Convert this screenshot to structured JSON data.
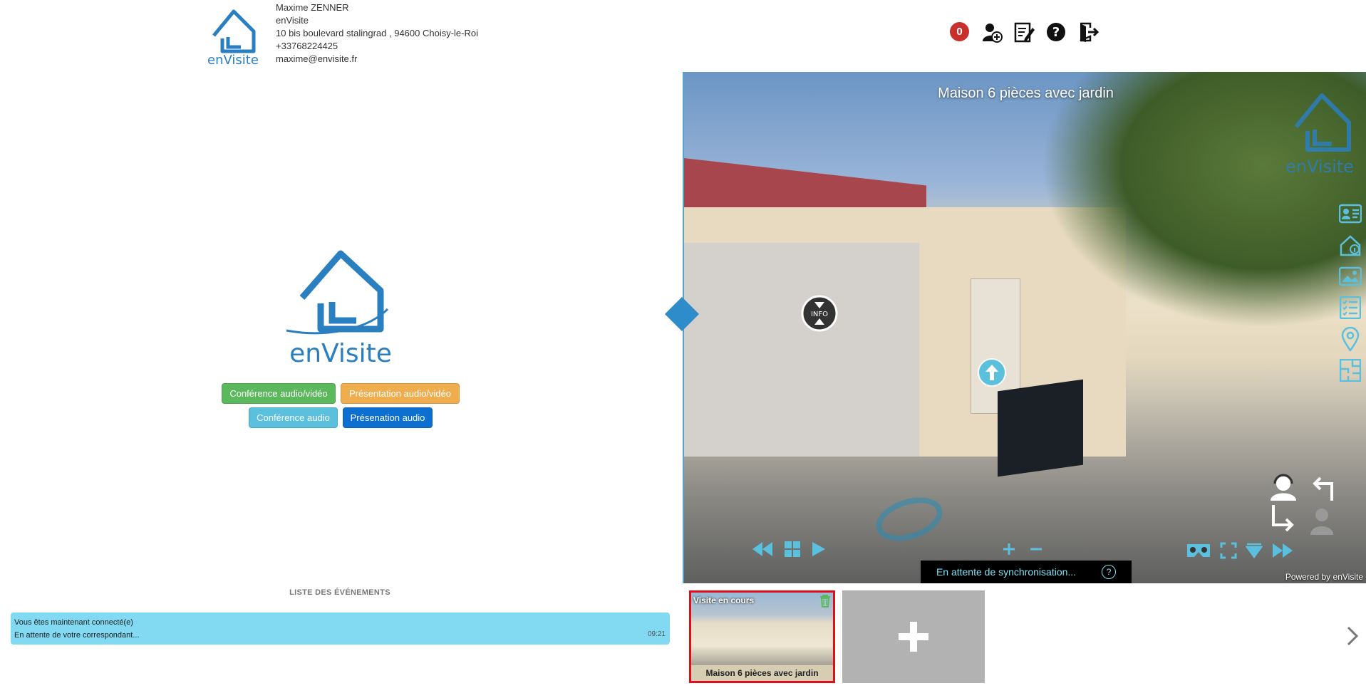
{
  "agent": {
    "name": "Maxime ZENNER",
    "company": "enVisite",
    "address": "10 bis boulevard stalingrad , 94600 Choisy-le-Roi",
    "phone": "+33768224425",
    "email": "maxime@envisite.fr"
  },
  "brand": {
    "name": "enVisite",
    "color": "#2a7fc1"
  },
  "toolbar": {
    "notification_count": "0",
    "icons": [
      "add-contact-icon",
      "notes-icon",
      "help-icon",
      "logout-icon"
    ]
  },
  "actions": {
    "conference_av": "Conférence audio/vidéo",
    "presentation_av": "Présentation audio/vidéo",
    "conference_audio": "Conférence audio",
    "presentation_audio": "Présenation audio"
  },
  "events": {
    "title": "LISTE DES ÉVÉNEMENTS",
    "items": [
      {
        "line1": "Vous êtes maintenant connecté(e)",
        "line2": "En attente de votre correspondant...",
        "time": "09:21"
      }
    ]
  },
  "viewer": {
    "title": "Maison 6 pièces avec jardin",
    "info_label": "INFO",
    "sync_status": "En attente de synchronisation...",
    "help": "?",
    "powered": "Powered by enVisite",
    "side_tools": [
      "contact-card-icon",
      "house-info-icon",
      "gallery-icon",
      "checklist-icon",
      "location-pin-icon",
      "floorplan-icon"
    ]
  },
  "thumbnails": {
    "current": {
      "status": "Visite en cours",
      "label": "Maison 6 pièces avec jardin"
    },
    "add_symbol": "+"
  },
  "colors": {
    "accent": "#4aa6d6",
    "sync_text": "#7ee3f5",
    "active_border": "#e10d1b"
  }
}
